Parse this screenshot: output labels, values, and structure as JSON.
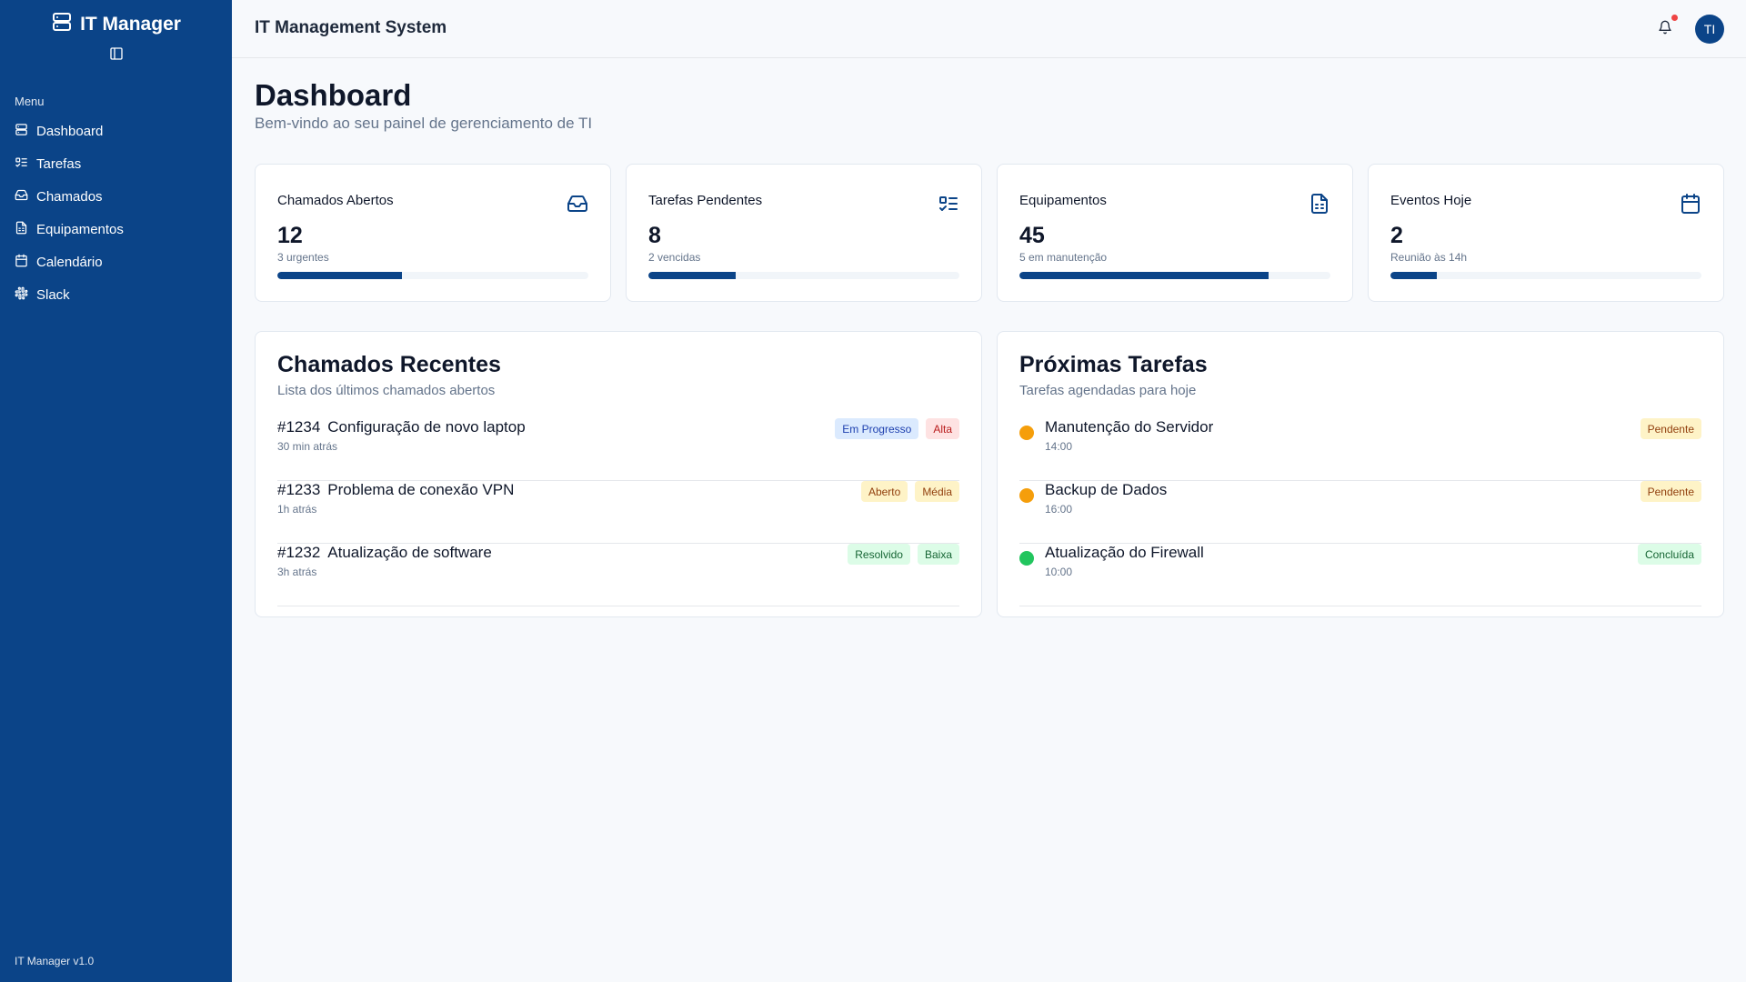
{
  "sidebar": {
    "brand": "IT Manager",
    "menu_label": "Menu",
    "items": [
      {
        "label": "Dashboard",
        "icon": "server-icon"
      },
      {
        "label": "Tarefas",
        "icon": "list-todo-icon"
      },
      {
        "label": "Chamados",
        "icon": "inbox-icon"
      },
      {
        "label": "Equipamentos",
        "icon": "file-spreadsheet-icon"
      },
      {
        "label": "Calendário",
        "icon": "calendar-icon"
      },
      {
        "label": "Slack",
        "icon": "slack-icon"
      }
    ],
    "version": "IT Manager v1.0"
  },
  "header": {
    "title": "IT Management System",
    "avatar_initials": "TI",
    "notification_icon": "bell-icon"
  },
  "page": {
    "title": "Dashboard",
    "subtitle": "Bem-vindo ao seu painel de gerenciamento de TI"
  },
  "stats": [
    {
      "label": "Chamados Abertos",
      "value": "12",
      "sub": "3 urgentes",
      "progress": 0.4,
      "icon": "inbox-icon"
    },
    {
      "label": "Tarefas Pendentes",
      "value": "8",
      "sub": "2 vencidas",
      "progress": 0.28,
      "icon": "list-todo-icon"
    },
    {
      "label": "Equipamentos",
      "value": "45",
      "sub": "5 em manutenção",
      "progress": 0.8,
      "icon": "file-spreadsheet-icon"
    },
    {
      "label": "Eventos Hoje",
      "value": "2",
      "sub": "Reunião às 14h",
      "progress": 0.15,
      "icon": "calendar-icon"
    }
  ],
  "tickets": {
    "title": "Chamados Recentes",
    "subtitle": "Lista dos últimos chamados abertos",
    "items": [
      {
        "id": "#1234",
        "title": "Configuração de novo laptop",
        "time": "30 min atrás",
        "status": "Em Progresso",
        "priority": "Alta"
      },
      {
        "id": "#1233",
        "title": "Problema de conexão VPN",
        "time": "1h atrás",
        "status": "Aberto",
        "priority": "Média"
      },
      {
        "id": "#1232",
        "title": "Atualização de software",
        "time": "3h atrás",
        "status": "Resolvido",
        "priority": "Baixa"
      }
    ]
  },
  "tasks": {
    "title": "Próximas Tarefas",
    "subtitle": "Tarefas agendadas para hoje",
    "items": [
      {
        "title": "Manutenção do Servidor",
        "time": "14:00",
        "status": "Pendente",
        "dot_color": "#f59e0b"
      },
      {
        "title": "Backup de Dados",
        "time": "16:00",
        "status": "Pendente",
        "dot_color": "#f59e0b"
      },
      {
        "title": "Atualização do Firewall",
        "time": "10:00",
        "status": "Concluída",
        "dot_color": "#22c55e"
      }
    ]
  },
  "colors": {
    "primary": "#0b4488",
    "badge_blue_bg": "#dbeafe",
    "badge_blue_fg": "#1e40af",
    "badge_red_bg": "#fee2e2",
    "badge_red_fg": "#b91c1c",
    "badge_yellow_bg": "#fef3c7",
    "badge_yellow_fg": "#92400e",
    "badge_green_bg": "#dcfce7",
    "badge_green_fg": "#166534"
  }
}
